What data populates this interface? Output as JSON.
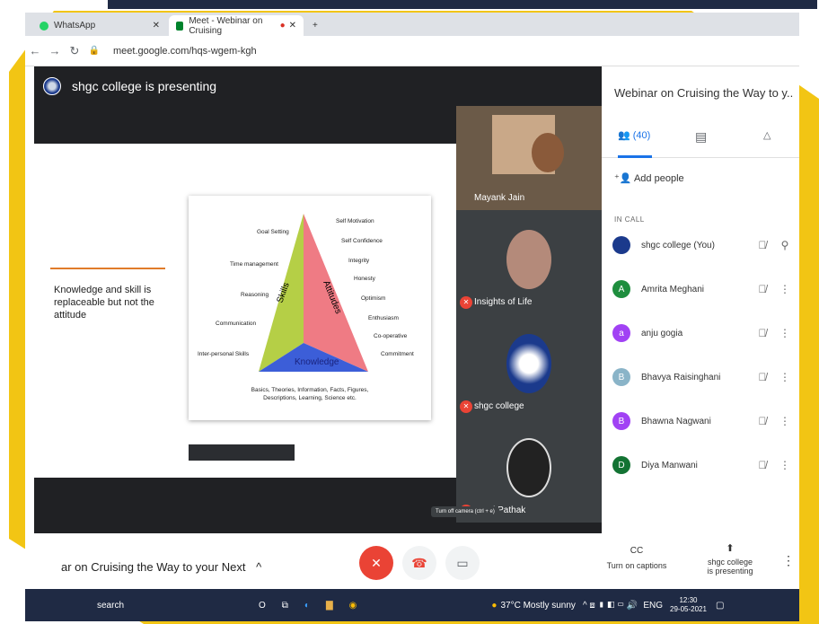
{
  "browser": {
    "tabs": [
      {
        "label": "WhatsApp"
      },
      {
        "label": "Meet - Webinar on Cruising"
      }
    ],
    "url": "meet.google.com/hqs-wgem-kgh"
  },
  "meet": {
    "presenting_title": "shgc college is presenting",
    "slide": {
      "text": "Knowledge and skill is replaceable but not the attitude",
      "diagram": {
        "left_labels": [
          "Goal Setting",
          "Time management",
          "Reasoning",
          "Communication",
          "Inter-personal Skills"
        ],
        "right_labels": [
          "Self Motivation",
          "Self Confidence",
          "Integrity",
          "Honesty",
          "Optimism",
          "Enthusiasm",
          "Co-operative",
          "Commitment"
        ],
        "skills": "Skills",
        "attitudes": "Attitudes",
        "knowledge": "Knowledge",
        "footer": "Basics, Theories, Information, Facts, Figures, Descriptions, Learning, Science etc."
      }
    },
    "tiles": [
      {
        "name": "Mayank Jain"
      },
      {
        "name": "Insights of Life"
      },
      {
        "name": "shgc college"
      },
      {
        "name": "Neeti Pathak"
      }
    ],
    "panel": {
      "title": "Webinar on Cruising the Way to y...",
      "people_count": "(40)",
      "add_people": "Add people",
      "in_call": "IN CALL",
      "people": [
        {
          "name": "shgc college (You)",
          "initial": "",
          "color": "#1b3a8c"
        },
        {
          "name": "Amrita Meghani",
          "initial": "A",
          "color": "#1e8e3e"
        },
        {
          "name": "anju gogia",
          "initial": "a",
          "color": "#a142f4"
        },
        {
          "name": "Bhavya Raisinghani",
          "initial": "B",
          "color": "#8ab4c8"
        },
        {
          "name": "Bhawna Nagwani",
          "initial": "B",
          "color": "#a142f4"
        },
        {
          "name": "Diya Manwani",
          "initial": "D",
          "color": "#137333"
        }
      ]
    },
    "bottom": {
      "meeting_name": "ar on Cruising the Way to your Next",
      "tooltip": "Turn off camera (ctrl + e)",
      "captions_label": "Turn on captions",
      "presenting_label_1": "shgc college",
      "presenting_label_2": "is presenting"
    }
  },
  "taskbar": {
    "search": "search",
    "weather": "37°C  Mostly sunny",
    "lang": "ENG",
    "time": "12:30",
    "date": "29-05-2021"
  },
  "colors": {
    "frame": "#f2c514",
    "meet_dark": "#202124",
    "accent_blue": "#1a73e8",
    "mute_red": "#ea4335"
  }
}
